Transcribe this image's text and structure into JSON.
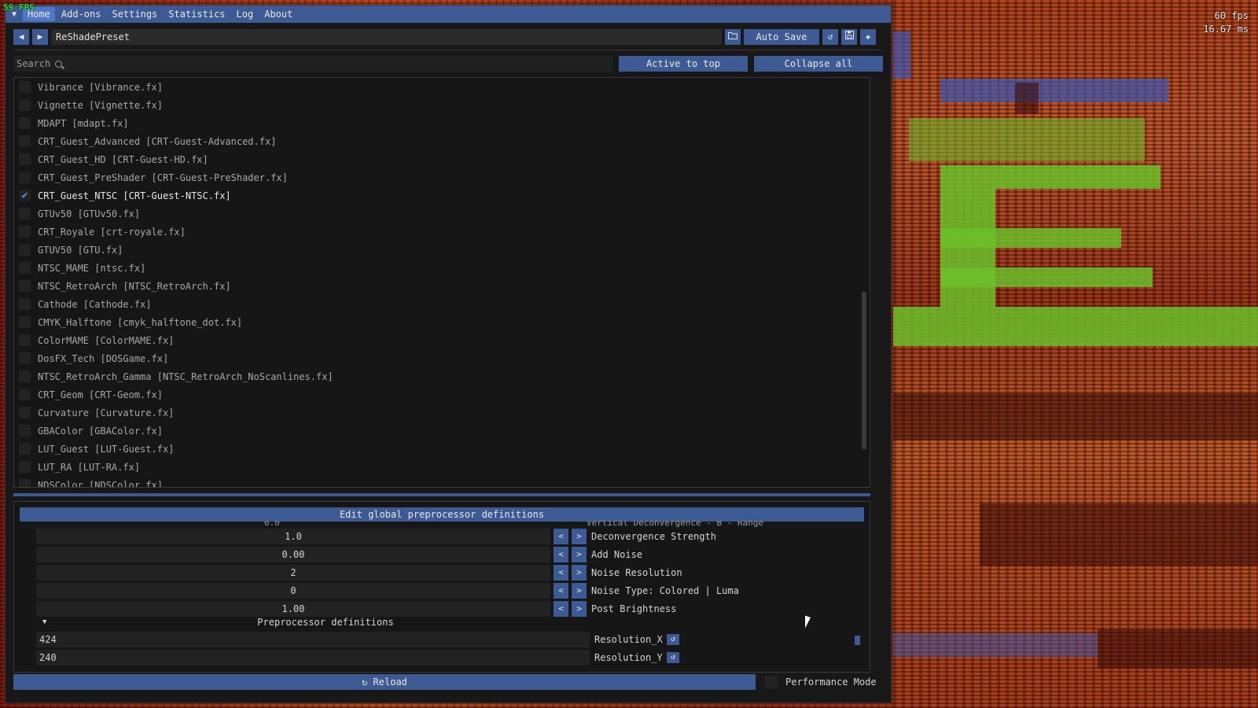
{
  "overlay": {
    "fps_corner": "59 FPS",
    "fps": "60 fps",
    "frame_time": "16.67 ms"
  },
  "menu": {
    "items": [
      "Home",
      "Add-ons",
      "Settings",
      "Statistics",
      "Log",
      "About"
    ],
    "active": "Home"
  },
  "toolbar": {
    "prev_icon": "arrow-left-icon",
    "next_icon": "arrow-right-icon",
    "preset_name": "ReShadePreset",
    "auto_save_label": "Auto Save",
    "folder_icon": "folder-icon",
    "reload_icon": "reload-icon",
    "save_icon": "save-icon",
    "add_icon": "plus-icon"
  },
  "search": {
    "placeholder": "Search",
    "active_to_top": "Active to top",
    "collapse_all": "Collapse all"
  },
  "effects": [
    {
      "label": "Vibrance [Vibrance.fx]",
      "enabled": false
    },
    {
      "label": "Vignette [Vignette.fx]",
      "enabled": false
    },
    {
      "label": "MDAPT [mdapt.fx]",
      "enabled": false
    },
    {
      "label": "CRT_Guest_Advanced [CRT-Guest-Advanced.fx]",
      "enabled": false
    },
    {
      "label": "CRT_Guest_HD [CRT-Guest-HD.fx]",
      "enabled": false
    },
    {
      "label": "CRT_Guest_PreShader [CRT-Guest-PreShader.fx]",
      "enabled": false
    },
    {
      "label": "CRT_Guest_NTSC [CRT-Guest-NTSC.fx]",
      "enabled": true
    },
    {
      "label": "GTUv50 [GTUv50.fx]",
      "enabled": false
    },
    {
      "label": "CRT_Royale [crt-royale.fx]",
      "enabled": false
    },
    {
      "label": "GTUV50 [GTU.fx]",
      "enabled": false
    },
    {
      "label": "NTSC_MAME [ntsc.fx]",
      "enabled": false
    },
    {
      "label": "NTSC_RetroArch [NTSC_RetroArch.fx]",
      "enabled": false
    },
    {
      "label": "Cathode [Cathode.fx]",
      "enabled": false
    },
    {
      "label": "CMYK_Halftone [cmyk_halftone_dot.fx]",
      "enabled": false
    },
    {
      "label": "ColorMAME [ColorMAME.fx]",
      "enabled": false
    },
    {
      "label": "DosFX_Tech [DOSGame.fx]",
      "enabled": false
    },
    {
      "label": "NTSC_RetroArch_Gamma [NTSC_RetroArch_NoScanlines.fx]",
      "enabled": false
    },
    {
      "label": "CRT_Geom [CRT-Geom.fx]",
      "enabled": false
    },
    {
      "label": "Curvature [Curvature.fx]",
      "enabled": false
    },
    {
      "label": "GBAColor [GBAColor.fx]",
      "enabled": false
    },
    {
      "label": "LUT_Guest [LUT-Guest.fx]",
      "enabled": false
    },
    {
      "label": "LUT_RA [LUT-RA.fx]",
      "enabled": false
    },
    {
      "label": "NDSColor [NDSColor.fx]",
      "enabled": false
    }
  ],
  "params": {
    "header": "Edit global preprocessor definitions",
    "rows": [
      {
        "value": "1.0",
        "label": "Deconvergence Strength"
      },
      {
        "value": "0.00",
        "label": "Add Noise"
      },
      {
        "value": "2",
        "label": "Noise Resolution"
      },
      {
        "value": "0",
        "label": "Noise Type: Colored | Luma"
      },
      {
        "value": "1.00",
        "label": "Post Brightness"
      }
    ],
    "section_title": "Preprocessor definitions",
    "definitions": [
      {
        "value": "424",
        "label": "Resolution_X"
      },
      {
        "value": "240",
        "label": "Resolution_Y"
      }
    ]
  },
  "footer": {
    "reload_label": "Reload",
    "performance_mode_label": "Performance Mode"
  }
}
